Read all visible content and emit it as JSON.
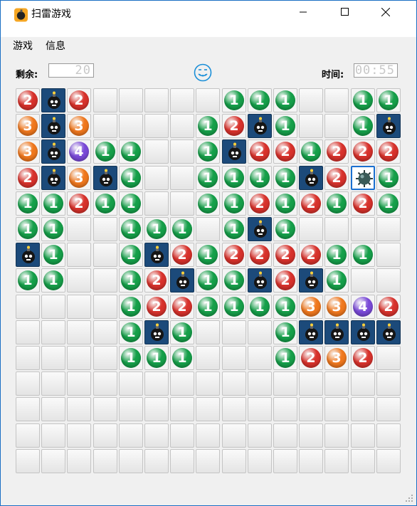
{
  "window": {
    "title": "扫雷游戏",
    "icon": "bomb-app-icon",
    "controls": {
      "minimize": "minimize-icon",
      "maximize": "maximize-icon",
      "close": "close-icon"
    }
  },
  "menu": {
    "items": [
      "游戏",
      "信息"
    ]
  },
  "toolbar": {
    "remaining_label": "剩余:",
    "remaining_value": "20",
    "time_label": "时间:",
    "time_value": "00:55",
    "face_icon": "smiley-face-icon"
  },
  "colors": {
    "n1": "#16a04a",
    "n2": "#d8322c",
    "n3": "#f0781e",
    "n4": "#7a4ad8",
    "mine_bg": "#1c4a7a",
    "accent": "#1a6fd0"
  },
  "board": {
    "rows": 15,
    "cols": 15,
    "legend": "H=unrevealed, E=empty, M=mine, X=exploded mine, 1-4=number",
    "grid": [
      "2M2HHHHH111HH11",
      "3M3HHHH12M1HH1M",
      "3M411HH1M221222",
      "2M3M1HH1111M2X1",
      "11211HH11212121",
      "11HH111H1M1HHHH",
      "M1HH1M21222211H",
      "11HH12M11M2M1HH",
      "HHHH12211113342",
      "HHHH1M1HHH1MMMM",
      "HHHH111HHH1232H",
      "HHHHHHHHHHHHHHH",
      "HHHHHHHHHHHHHHH",
      "HHHHHHHHHHHHHHH",
      "HHHHHHHHHHHHHHH"
    ]
  }
}
